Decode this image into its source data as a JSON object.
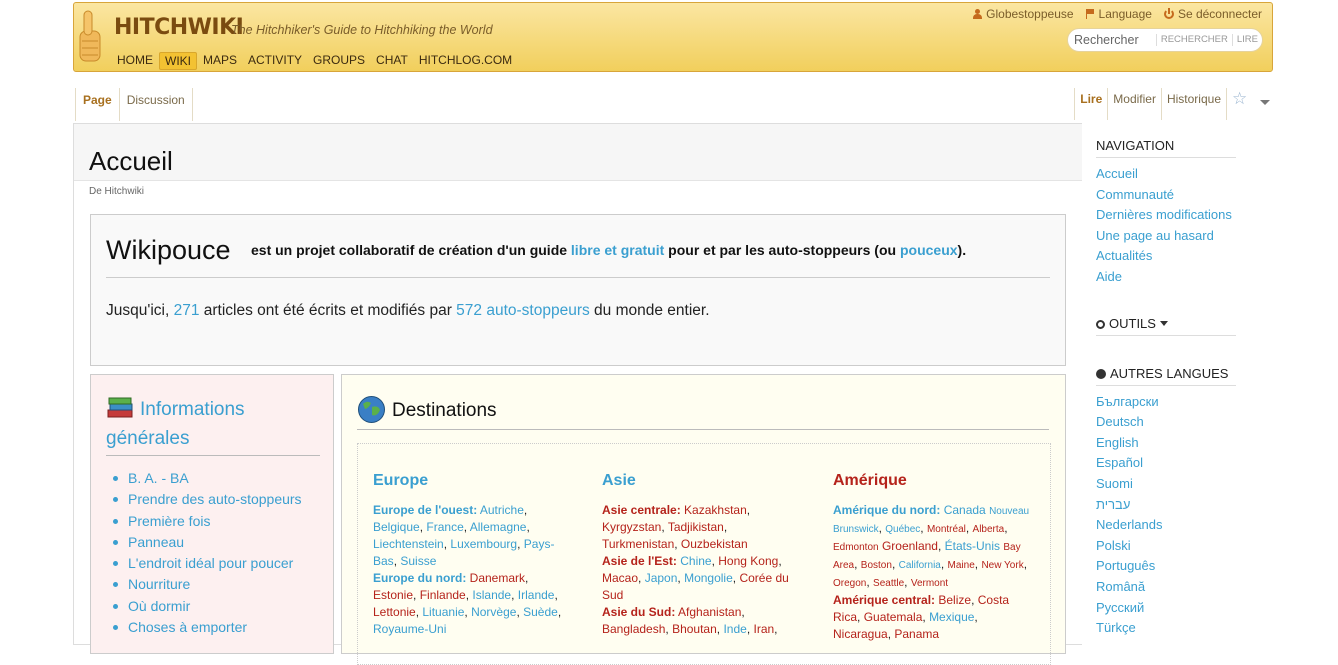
{
  "header": {
    "logo": "HITCHWIKI",
    "tagline": "The Hitchhiker's Guide to Hitchhiking the World",
    "nav": [
      "HOME",
      "WIKI",
      "MAPS",
      "ACTIVITY",
      "GROUPS",
      "CHAT",
      "HITCHLOG.COM"
    ],
    "active_nav": "WIKI",
    "user": "Globestoppeuse",
    "language": "Language",
    "logout": "Se déconnecter",
    "search_placeholder": "Rechercher",
    "search_button": "RECHERCHER",
    "read_button": "LIRE"
  },
  "tabs": {
    "page": "Page",
    "discussion": "Discussion",
    "read": "Lire",
    "edit": "Modifier",
    "history": "Historique"
  },
  "page": {
    "title": "Accueil",
    "subtitle": "De Hitchwiki"
  },
  "intro": {
    "wikipouce": "Wikipouce",
    "desc_a": "est un projet collaboratif de création d'un guide ",
    "desc_link1": "libre et gratuit",
    "desc_b": " pour et par les auto-stoppeurs (ou ",
    "desc_link2": "pouceux",
    "desc_c": ").",
    "stats_a": "Jusqu'ici, ",
    "stats_articles": "271",
    "stats_b": " articles ont été écrits et modifiés par ",
    "stats_users": "572 auto-stoppeurs",
    "stats_c": " du monde entier."
  },
  "info": {
    "heading": "Informations générales",
    "items": [
      "B. A. - BA",
      "Prendre des auto-stoppeurs",
      "Première fois",
      "Panneau",
      "L'endroit idéal pour poucer",
      "Nourriture",
      "Où dormir",
      "Choses à emporter"
    ]
  },
  "destinations": {
    "heading": "Destinations",
    "europe": "Europe",
    "asie": "Asie",
    "amerique": "Amérique"
  },
  "sidebar": {
    "navigation": "NAVIGATION",
    "nav_items": [
      "Accueil",
      "Communauté",
      "Dernières modifications",
      "Une page au hasard",
      "Actualités",
      "Aide"
    ],
    "tools": "OUTILS",
    "languages_heading": "AUTRES LANGUES",
    "languages": [
      "Български",
      "Deutsch",
      "English",
      "Español",
      "Suomi",
      "עברית",
      "Nederlands",
      "Polski",
      "Português",
      "Română",
      "Русский",
      "Türkçe"
    ]
  },
  "colors": {
    "link": "#3a9fd0",
    "banner": "#f1cf5c",
    "red_link": "#b5231b"
  }
}
